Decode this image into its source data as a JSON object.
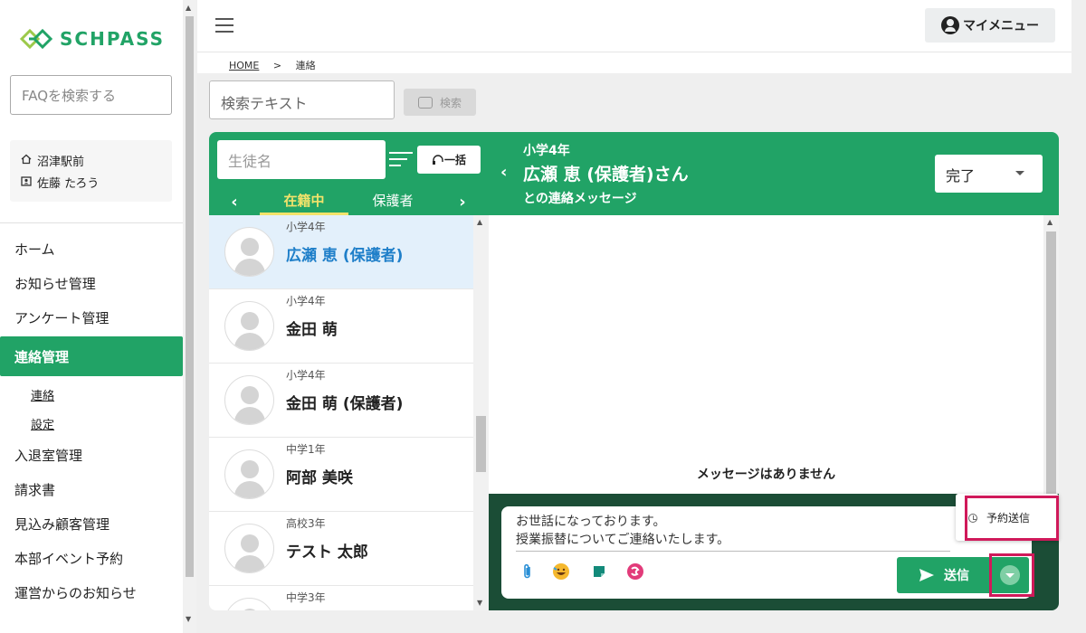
{
  "app": {
    "logo_text": "SCHPASS",
    "brand_color": "#21a366",
    "faq_search_placeholder": "FAQを検索する",
    "school_name": "沼津駅前",
    "user_name": "佐藤 たろう"
  },
  "sidebar": {
    "items": [
      {
        "label": "ホーム"
      },
      {
        "label": "お知らせ管理"
      },
      {
        "label": "アンケート管理"
      },
      {
        "label": "連絡管理"
      },
      {
        "label": "入退室管理"
      },
      {
        "label": "請求書"
      },
      {
        "label": "見込み顧客管理"
      },
      {
        "label": "本部イベント予約"
      },
      {
        "label": "運営からのお知らせ"
      }
    ],
    "subitems": [
      {
        "label": "連絡"
      },
      {
        "label": "設定"
      }
    ]
  },
  "header": {
    "my_menu_label": "マイメニュー"
  },
  "breadcrumb": {
    "home": "HOME",
    "separator": ">",
    "current": "連絡"
  },
  "search": {
    "placeholder": "検索テキスト",
    "button_label": "検索"
  },
  "student_panel": {
    "name_placeholder": "生徒名",
    "bulk_button_label": "一括",
    "tabs": [
      {
        "label": "在籍中"
      },
      {
        "label": "保護者"
      }
    ],
    "students": [
      {
        "grade": "小学4年",
        "name": "広瀬 恵 (保護者)"
      },
      {
        "grade": "小学4年",
        "name": "金田 萌"
      },
      {
        "grade": "小学4年",
        "name": "金田 萌 (保護者)"
      },
      {
        "grade": "中学1年",
        "name": "阿部 美咲"
      },
      {
        "grade": "高校3年",
        "name": "テスト 太郎"
      },
      {
        "grade": "中学3年",
        "name": ""
      }
    ]
  },
  "chat": {
    "grade": "小学4年",
    "recipient": "広瀬 恵 (保護者)さん",
    "subtitle": "との連絡メッセージ",
    "status": "完了",
    "empty_message": "メッセージはありません",
    "draft_line1": "お世話になっております。",
    "draft_line2": "授業振替についてご連絡いたします。",
    "tools": [
      "paperclip-icon",
      "emoji-icon",
      "template-icon",
      "stamp-icon"
    ],
    "send_label": "送信",
    "schedule_label": "予約送信",
    "highlight_color": "#d0195a"
  }
}
